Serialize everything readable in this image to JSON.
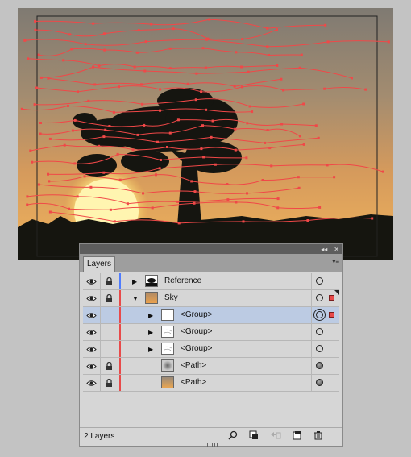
{
  "panel": {
    "tab_label": "Layers",
    "collapse_glyph": "◂◂",
    "close_glyph": "✕",
    "menu_glyph": "▾≡",
    "footer_count": "2 Layers",
    "footer_icons": [
      "search-icon",
      "make-clip-mask-icon",
      "collect-new-layer-icon",
      "new-sublayer-icon",
      "delete-icon"
    ]
  },
  "layers": [
    {
      "label": "Reference",
      "indent": 0,
      "expander": "▶",
      "color": "#4f7cff",
      "locked": true,
      "thumb": "silhouette",
      "target": "ring",
      "selected": false,
      "sel_square": false,
      "corner": false
    },
    {
      "label": "Sky",
      "indent": 0,
      "expander": "▼",
      "color": "#e84a4a",
      "locked": true,
      "thumb": "sunset",
      "target": "ring",
      "selected": false,
      "sel_square": true,
      "corner": true
    },
    {
      "label": "<Group>",
      "indent": 1,
      "expander": "▶",
      "color": "#e84a4a",
      "locked": false,
      "thumb": "blank",
      "target": "double",
      "selected": true,
      "sel_square": true,
      "corner": false
    },
    {
      "label": "<Group>",
      "indent": 1,
      "expander": "▶",
      "color": "#e84a4a",
      "locked": false,
      "thumb": "lines",
      "target": "ring",
      "selected": false,
      "sel_square": false,
      "corner": false
    },
    {
      "label": "<Group>",
      "indent": 1,
      "expander": "▶",
      "color": "#e84a4a",
      "locked": false,
      "thumb": "lines",
      "target": "ring",
      "selected": false,
      "sel_square": false,
      "corner": false
    },
    {
      "label": "<Path>",
      "indent": 1,
      "expander": "",
      "color": "#e84a4a",
      "locked": true,
      "thumb": "blur",
      "target": "filled",
      "selected": false,
      "sel_square": false,
      "corner": false
    },
    {
      "label": "<Path>",
      "indent": 1,
      "expander": "",
      "color": "#e84a4a",
      "locked": true,
      "thumb": "gradient",
      "target": "filled",
      "selected": false,
      "sel_square": false,
      "corner": false
    }
  ],
  "colors": {
    "path_stroke": "#f04848",
    "selection": "#bccbe3"
  }
}
